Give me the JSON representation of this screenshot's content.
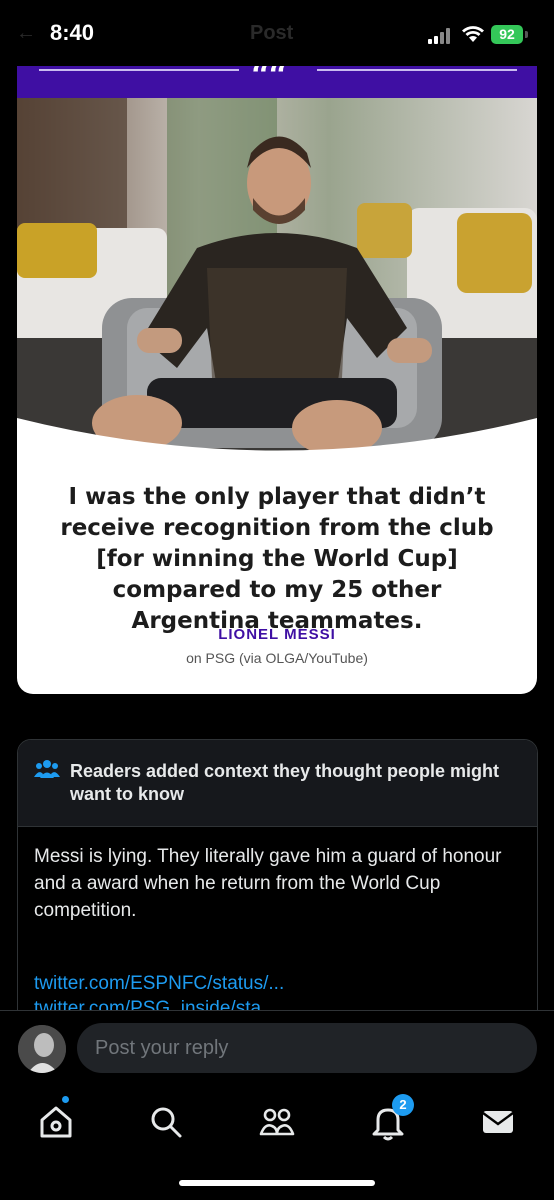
{
  "status_bar": {
    "time": "8:40",
    "battery": "92",
    "header_ghost": "Post",
    "back_ghost": "←"
  },
  "card": {
    "quote_mark": "““",
    "quote_text": "I was the only player that didn’t receive recognition from the club [for winning the World Cup] compared to my 25 other Argentina teammates.",
    "attribution_name": "LIONEL MESSI",
    "attribution_source": "on PSG (via OLGA/YouTube)"
  },
  "context": {
    "title": "Readers added context they thought people might want to know",
    "body": "Messi is lying. They literally gave him a guard of honour and a award when he return from the World Cup competition.",
    "link1": "twitter.com/ESPNFC/status/...",
    "link2": "twitter.com/PSG_inside/sta..."
  },
  "reply": {
    "placeholder": "Post your reply"
  },
  "tabbar": {
    "notifications_count": "2"
  },
  "colors": {
    "accent": "#1d9bf0",
    "espn_purple": "#3f0fa3"
  }
}
